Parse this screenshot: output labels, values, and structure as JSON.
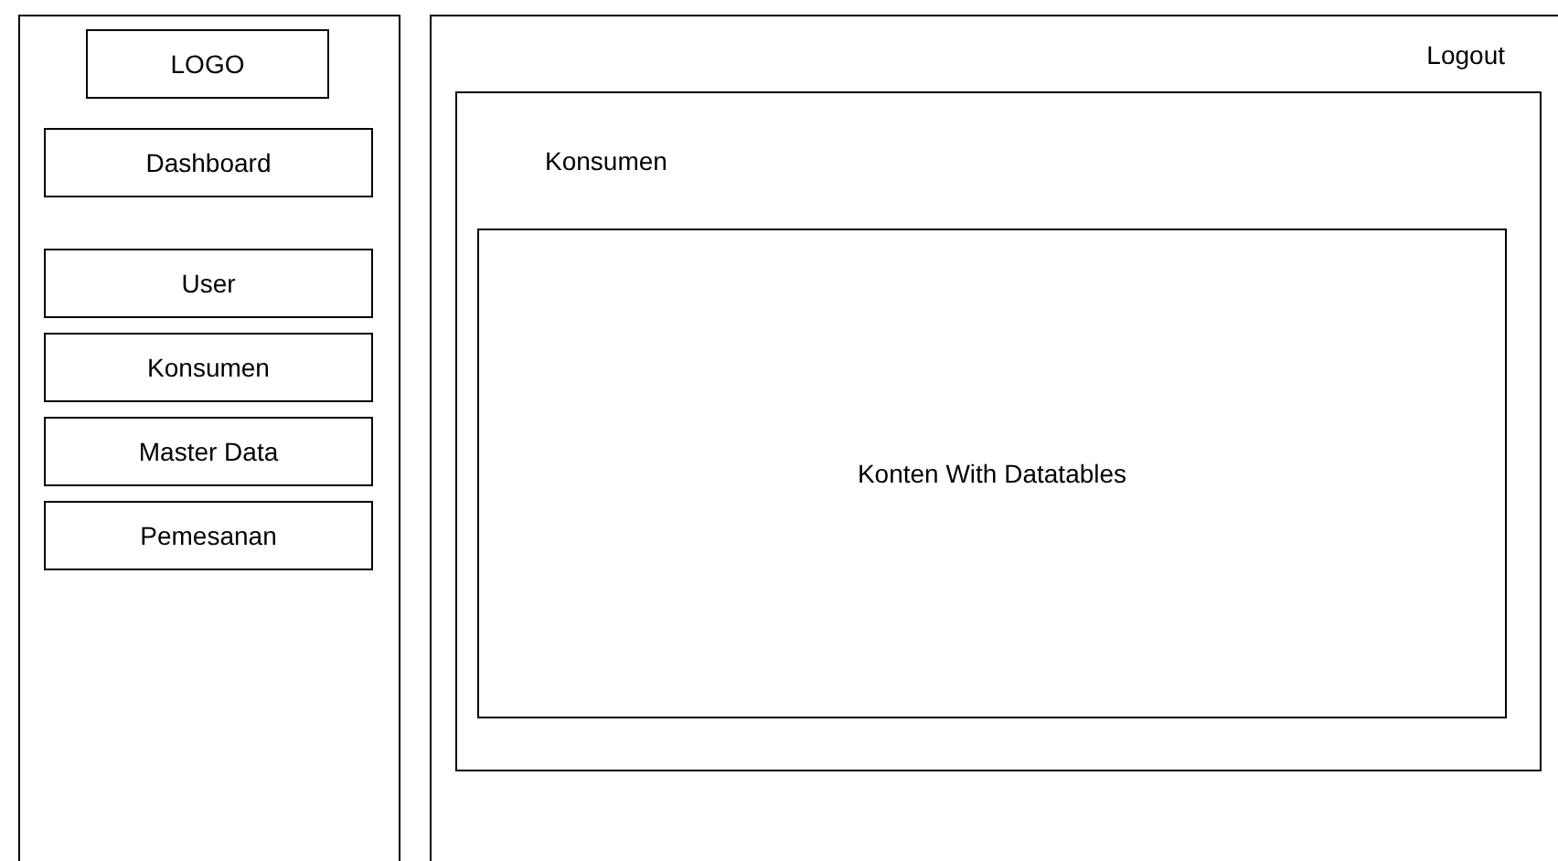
{
  "sidebar": {
    "logo": "LOGO",
    "nav_groups": [
      {
        "items": [
          {
            "label": "Dashboard"
          }
        ]
      },
      {
        "items": [
          {
            "label": "User"
          },
          {
            "label": "Konsumen"
          },
          {
            "label": "Master Data"
          },
          {
            "label": "Pemesanan"
          }
        ]
      }
    ]
  },
  "header": {
    "logout": "Logout"
  },
  "content": {
    "title": "Konsumen",
    "body": "Konten With Datatables"
  }
}
